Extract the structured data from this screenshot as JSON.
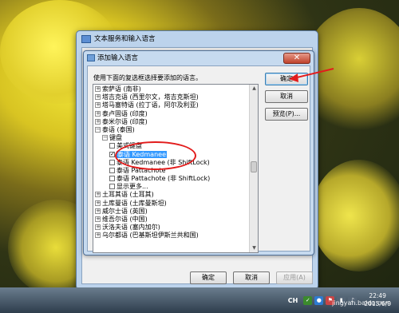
{
  "outer_dialog": {
    "title": "文本服务和输入语言",
    "buttons": {
      "ok": "确定",
      "cancel": "取消",
      "apply": "应用(A)"
    }
  },
  "inner_dialog": {
    "title": "添加输入语言",
    "close_glyph": "✕",
    "instruction": "使用下面的复选框选择要添加的语言。",
    "buttons": {
      "ok": "确定",
      "cancel": "取消",
      "preview": "预览(P)..."
    },
    "tree": {
      "items": [
        {
          "expander": "+",
          "label": "索萨语 (南非)",
          "indent": 1
        },
        {
          "expander": "+",
          "label": "塔吉克语 (西里尔文，塔吉克斯坦)",
          "indent": 1
        },
        {
          "expander": "+",
          "label": "塔马塞特语 (拉丁语，阿尔及利亚)",
          "indent": 1
        },
        {
          "expander": "+",
          "label": "泰卢固语 (印度)",
          "indent": 1
        },
        {
          "expander": "+",
          "label": "泰米尔语 (印度)",
          "indent": 1
        },
        {
          "expander": "−",
          "label": "泰语 (泰国)",
          "indent": 1
        },
        {
          "expander": "−",
          "label": "键盘",
          "indent": 2
        },
        {
          "checkbox": false,
          "label": "美式键盘",
          "indent": 3
        },
        {
          "checkbox": true,
          "label": "泰语 Kedmanee",
          "indent": 3,
          "selected": true
        },
        {
          "checkbox": false,
          "label": "泰语 Kedmanee (非 ShiftLock)",
          "indent": 3
        },
        {
          "checkbox": false,
          "label": "泰语 Pattachote",
          "indent": 3
        },
        {
          "checkbox": false,
          "label": "泰语 Pattachote (非 ShiftLock)",
          "indent": 3
        },
        {
          "checkbox": false,
          "label": "显示更多...",
          "indent": 3
        },
        {
          "expander": "+",
          "label": "土耳其语 (土耳其)",
          "indent": 1
        },
        {
          "expander": "+",
          "label": "土库曼语 (土库曼斯坦)",
          "indent": 1
        },
        {
          "expander": "+",
          "label": "威尔士语 (英国)",
          "indent": 1
        },
        {
          "expander": "+",
          "label": "维吾尔语 (中国)",
          "indent": 1
        },
        {
          "expander": "+",
          "label": "沃洛夫语 (塞内加尔)",
          "indent": 1
        },
        {
          "expander": "+",
          "label": "乌尔都语 (巴基斯坦伊斯兰共和国)",
          "indent": 1
        }
      ]
    }
  },
  "taskbar": {
    "lang": "CH",
    "time": "22:49",
    "date": "2015/6/9"
  },
  "watermark": "jingyan.baidu.com",
  "colors": {
    "annotation": "#e21c1c",
    "selection": "#3399ff"
  }
}
